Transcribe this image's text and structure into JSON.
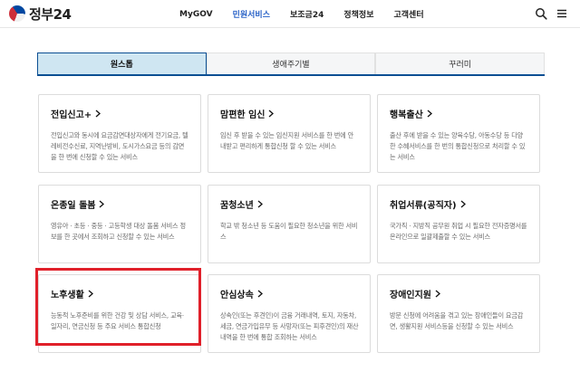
{
  "header": {
    "logo_text": "정부24",
    "nav": [
      "MyGOV",
      "민원서비스",
      "보조금24",
      "정책정보",
      "고객센터"
    ],
    "active_nav_index": 1,
    "accent_color": "#2a63c7",
    "icons": [
      "search-icon",
      "menu-icon"
    ]
  },
  "tabs": [
    {
      "label": "원스톱",
      "active": true
    },
    {
      "label": "생애주기별",
      "active": false
    },
    {
      "label": "꾸러미",
      "active": false
    }
  ],
  "cards": [
    {
      "title": "전입신고+",
      "desc": "전입신고와 동시에 요금감면대상자에게 전기요금, 텔레비전수신료, 지역난방비, 도시가스요금 등의 감면을 한 번에 신청할 수 있는 서비스"
    },
    {
      "title": "맘편한 임신",
      "desc": "임신 후 받을 수 있는 임신지원 서비스를 한 번에 안내받고 편리하게 통합신청 할 수 있는 서비스"
    },
    {
      "title": "행복출산",
      "desc": "출산 후에 받을 수 있는 양육수당, 아동수당 등 다양한 수혜서비스를 한 번의 통합신청으로 처리할 수 있는 서비스"
    },
    {
      "title": "온종일 돌봄",
      "desc": "영유아 · 초등 · 중등 · 고등학생 대상 돌봄 서비스 정보를 한 곳에서 조회하고 신청할 수 있는 서비스"
    },
    {
      "title": "꿈청소년",
      "desc": "학교 밖 청소년 등 도움이 필요한 청소년을 위한 서비스"
    },
    {
      "title": "취업서류(공직자)",
      "desc": "국가직 · 지방직 공무원 취업 시 필요한 전자증명서를 온라인으로 일괄제출할 수 있는 서비스"
    },
    {
      "title": "노후생활",
      "desc": "능동적 노후준비를 위한 건강 및 상담 서비스, 교육·일자리, 연금신청 등 주요 서비스 통합신청"
    },
    {
      "title": "안심상속",
      "desc": "상속인(또는 후견인)이 금융 거래내역, 토지, 자동차, 세금, 연금가입유무 등 사망자(또는 피후견인)의 재산내역을 한 번에 통합 조회하는 서비스"
    },
    {
      "title": "장애인지원",
      "desc": "방문 신청에 어려움을 겪고 있는 장애인들이 요금감면, 생활지원 서비스등을 신청할 수 있는 서비스"
    }
  ],
  "highlight_color": "#e0202a"
}
